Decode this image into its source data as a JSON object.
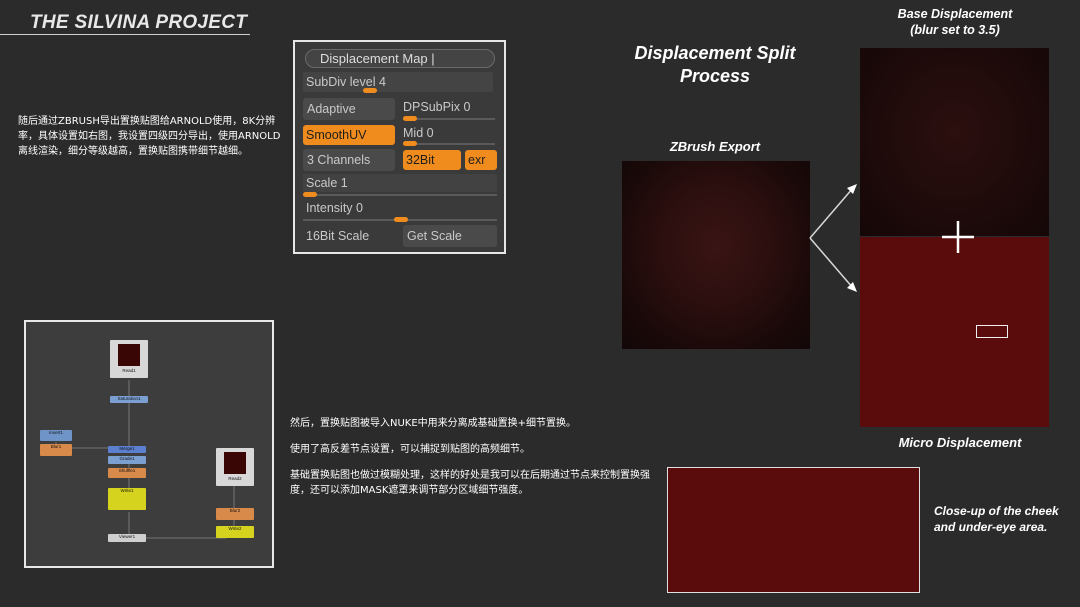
{
  "project_title": "THE SILVINA PROJECT",
  "intro_text": "随后通过ZBRUSH导出置换贴图给ARNOLD使用，8K分辨率，具体设置如右图，我设置四级四分导出，使用ARNOLD离线渲染，细分等级越高，置换贴图携带细节越细。",
  "zbrush_panel": {
    "displacement_map": "Displacement Map |",
    "subdiv_level": "SubDiv level 4",
    "adaptive": "Adaptive",
    "dpsubpix": "DPSubPix 0",
    "smoothuv": "SmoothUV",
    "mid": "Mid 0",
    "channels": "3 Channels",
    "bit32": "32Bit",
    "exr": "exr",
    "scale": "Scale 1",
    "intensity": "Intensity 0",
    "bit16_scale": "16Bit Scale",
    "get_scale": "Get Scale"
  },
  "split_title_line1": "Displacement Split",
  "split_title_line2": "Process",
  "zbrush_export_label": "ZBrush Export",
  "base_label_line1": "Base Displacement",
  "base_label_line2": "(blur set to 3.5)",
  "micro_label": "Micro Displacement",
  "closeup_label": "Close-up of the cheek and under-eye area.",
  "nuke_text": {
    "p1": "然后，置换贴图被导入NUKE中用来分离成基础置换+细节置换。",
    "p2": "使用了高反差节点设置，可以捕捉到贴图的高频细节。",
    "p3": "基础置换贴图也做过模糊处理，这样的好处是我可以在后期通过节点来控制置换强度，还可以添加MASK遮罩来调节部分区域细节强度。"
  },
  "nuke_nodes": {
    "read1": "Read1",
    "read2": "Read2",
    "saturation": "Saturation1",
    "invert": "Invert1",
    "blur1": "Blur1",
    "merge": "Merge1",
    "grade": "Grade1",
    "shuffle": "Shuffle1",
    "write1": "Write1",
    "viewer": "Viewer1",
    "blur2": "Blur2",
    "write2": "Write2"
  },
  "colors": {
    "accent_orange": "#f08c1e",
    "map_red": "#5a0c0c",
    "background": "#2b2b2b"
  }
}
